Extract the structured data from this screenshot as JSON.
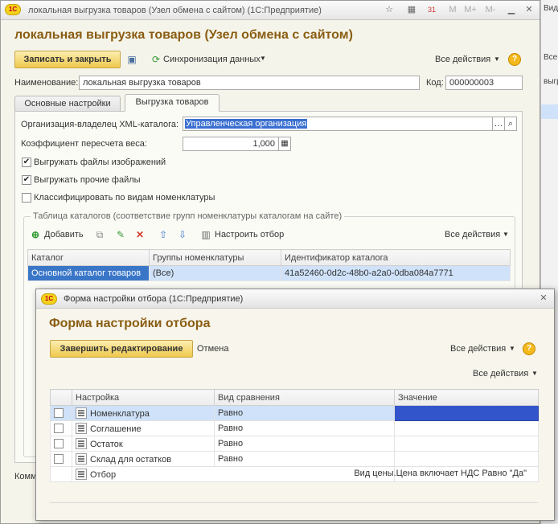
{
  "window": {
    "title": "локальная выгрузка товаров (Узел обмена с сайтом)  (1С:Предприятие)",
    "logo_text": "1С",
    "heading": "локальная выгрузка товаров (Узел обмена с сайтом)",
    "titlebar_icons": [
      "star-icon",
      "calculator-icon",
      "calendar-icon",
      "m-icon",
      "m-plus-icon",
      "m-minus-icon",
      "minimize-icon",
      "close-icon"
    ],
    "titlebar_labels": {
      "m": "M",
      "mplus": "M+",
      "mminus": "M-",
      "calendar": "31"
    }
  },
  "toolbar": {
    "save_close": "Записать и закрыть",
    "sync": "Синхронизация данных",
    "all_actions": "Все действия"
  },
  "form": {
    "name_label": "Наименование:",
    "name_value": "локальная выгрузка товаров",
    "code_label": "Код:",
    "code_value": "000000003"
  },
  "tabs": [
    {
      "label": "Основные настройки"
    },
    {
      "label": "Выгрузка товаров"
    }
  ],
  "export": {
    "org_label": "Организация-владелец XML-каталога:",
    "org_value": "Управленческая организация",
    "weight_label": "Коэффициент пересчета веса:",
    "weight_value": "1,000",
    "checkboxes": [
      {
        "label": "Выгружать файлы изображений",
        "checked": true
      },
      {
        "label": "Выгружать прочие файлы",
        "checked": true
      },
      {
        "label": "Классифицировать по видам номенклатуры",
        "checked": false
      }
    ],
    "group_title": "Таблица каталогов (соответствие групп номенклатуры каталогам на сайте)",
    "add_label": "Добавить",
    "filter_label": "Настроить отбор",
    "all_actions": "Все действия",
    "columns": [
      "Каталог",
      "Группы номенклатуры",
      "Идентификатор каталога"
    ],
    "rows": [
      {
        "catalog": "Основной каталог товаров",
        "groups": "(Все)",
        "id": "41a52460-0d2c-48b0-a2a0-0dba084a7771"
      }
    ]
  },
  "bottom_label": "Комм",
  "right_strip": {
    "top": "Виде",
    "mid": "Все",
    "lower": "выгру"
  },
  "dialog": {
    "title": "Форма настройки отбора  (1С:Предприятие)",
    "heading": "Форма настройки отбора",
    "finish": "Завершить редактирование",
    "cancel": "Отмена",
    "all_actions": "Все действия",
    "all_actions2": "Все действия",
    "columns": [
      "Настройка",
      "Вид сравнения",
      "Значение"
    ],
    "rows": [
      {
        "name": "Номенклатура",
        "cmp": "Равно",
        "value": ""
      },
      {
        "name": "Соглашение",
        "cmp": "Равно",
        "value": ""
      },
      {
        "name": "Остаток",
        "cmp": "Равно",
        "value": ""
      },
      {
        "name": "Склад для остатков",
        "cmp": "Равно",
        "value": ""
      }
    ],
    "filter_row": {
      "name": "Отбор",
      "value": "Вид цены.Цена включает НДС Равно \"Да\""
    }
  },
  "colors": {
    "accent": "#8a5d12",
    "selection": "#cfe2f9",
    "button": "#efc84c",
    "value_highlight": "#3355cc"
  }
}
